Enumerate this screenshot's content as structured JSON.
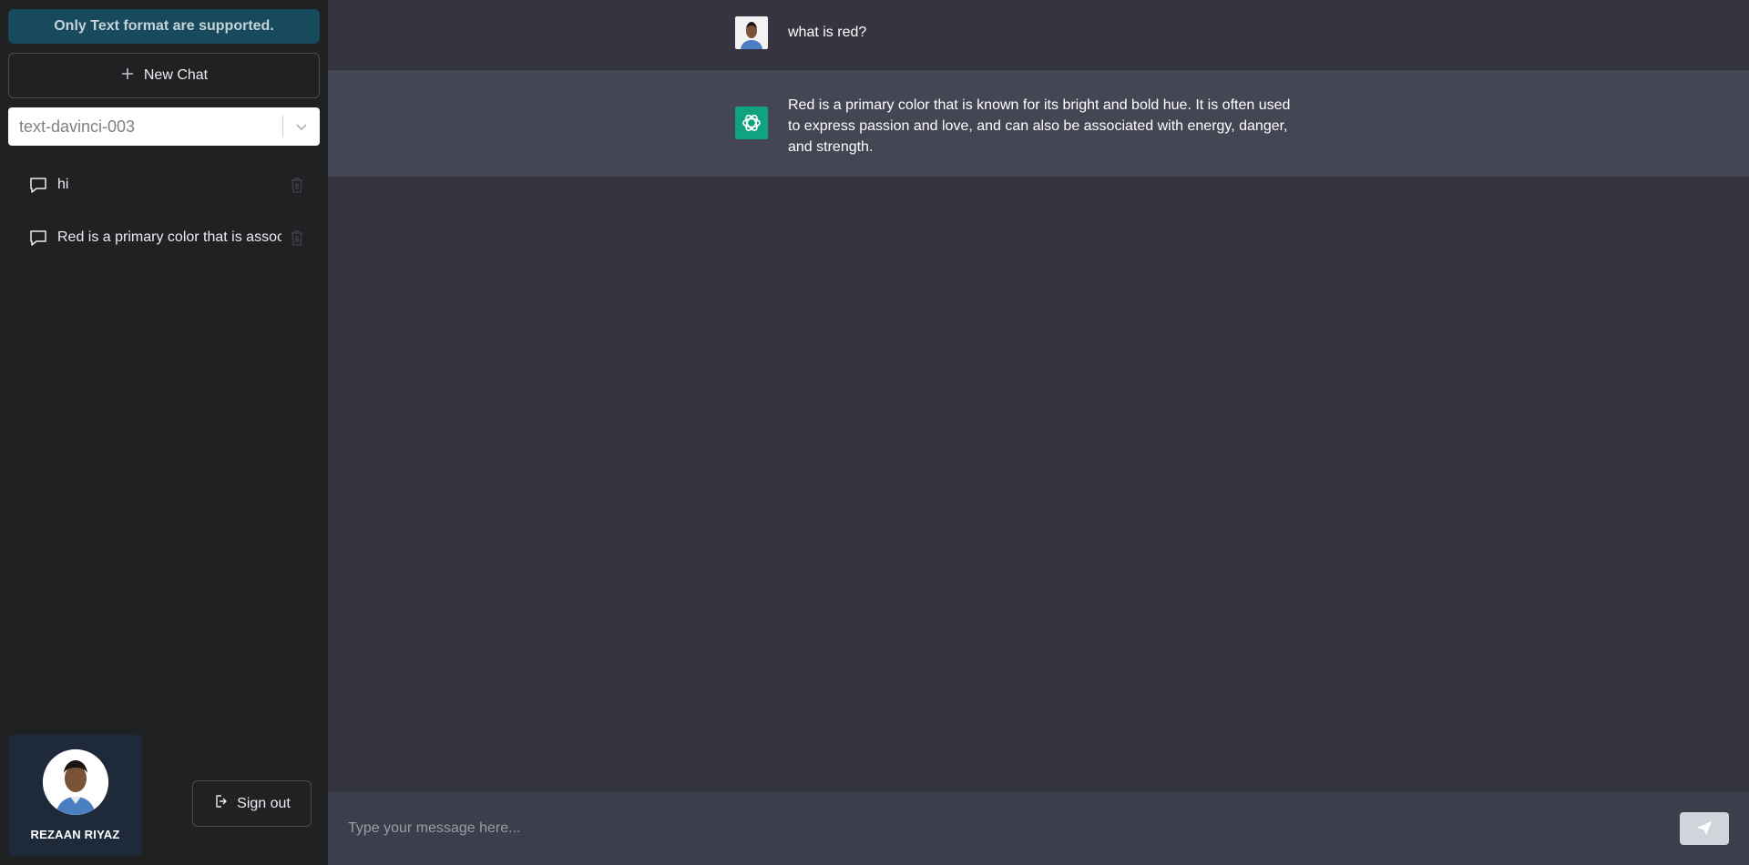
{
  "sidebar": {
    "notice": "Only Text format are supported.",
    "new_chat_label": "New Chat",
    "model": {
      "selected": "text-davinci-003"
    },
    "history": [
      {
        "label": "hi"
      },
      {
        "label": "Red is a primary color that is associated with"
      }
    ],
    "profile": {
      "name": "REZAAN RIYAZ"
    },
    "signout_label": "Sign out"
  },
  "conversation": {
    "user_message": "what is red?",
    "bot_message": "Red is a primary color that is known for its bright and bold hue. It is often used to express passion and love, and can also be associated with energy, danger, and strength."
  },
  "input": {
    "placeholder": "Type your message here..."
  },
  "colors": {
    "sidebar_bg": "#202123",
    "main_bg": "#343541",
    "bot_row_bg": "#444654",
    "notice_bg": "#174a5c",
    "openai_green": "#10a37f",
    "profile_card_bg": "#1e2a3a"
  },
  "icons": [
    "plus-icon",
    "chevron-down-icon",
    "chat-bubble-icon",
    "trash-icon",
    "sign-out-icon",
    "openai-logo-icon",
    "send-icon"
  ]
}
